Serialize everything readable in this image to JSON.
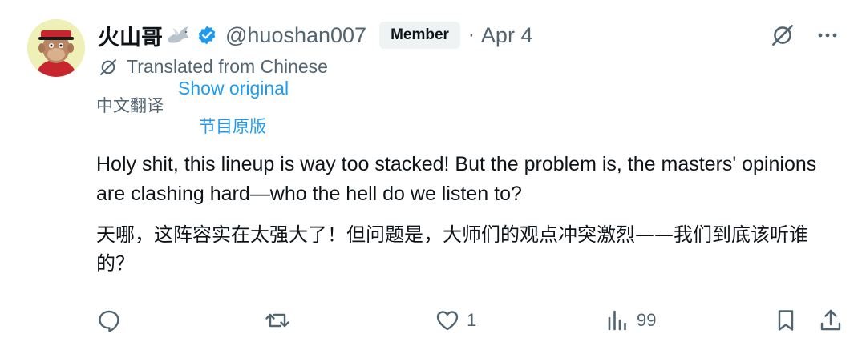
{
  "user": {
    "display_name": "火山哥",
    "handle": "@huoshan007",
    "badge": "Member",
    "separator": "·",
    "date": "Apr 4"
  },
  "translation": {
    "notice": "Translated from Chinese",
    "source_label": "中文翻译",
    "show_original": "Show original",
    "show_original_zh": "节目原版"
  },
  "tweet": {
    "text_en": "Holy shit, this lineup is way too stacked! But the problem is, the masters' opinions are clashing hard—who the hell do we listen to?",
    "text_zh": "天哪，这阵容实在太强大了！但问题是，大师们的观点冲突激烈——我们到底该听谁的？"
  },
  "actions": {
    "reply_count": "",
    "retweet_count": "",
    "like_count": "1",
    "views_count": "99"
  },
  "icons": {
    "avatar": "ape-avatar",
    "dove": "dove-icon",
    "verified": "verified-badge-icon",
    "translate": "translate-icon",
    "more": "more-icon",
    "reply": "reply-icon",
    "retweet": "retweet-icon",
    "like": "heart-icon",
    "views": "views-icon",
    "bookmark": "bookmark-icon",
    "share": "share-icon"
  },
  "colors": {
    "text": "#0f1419",
    "secondary": "#536471",
    "link": "#1d9bf0",
    "verified": "#1d9bf0",
    "badge_bg": "#eff3f4"
  }
}
